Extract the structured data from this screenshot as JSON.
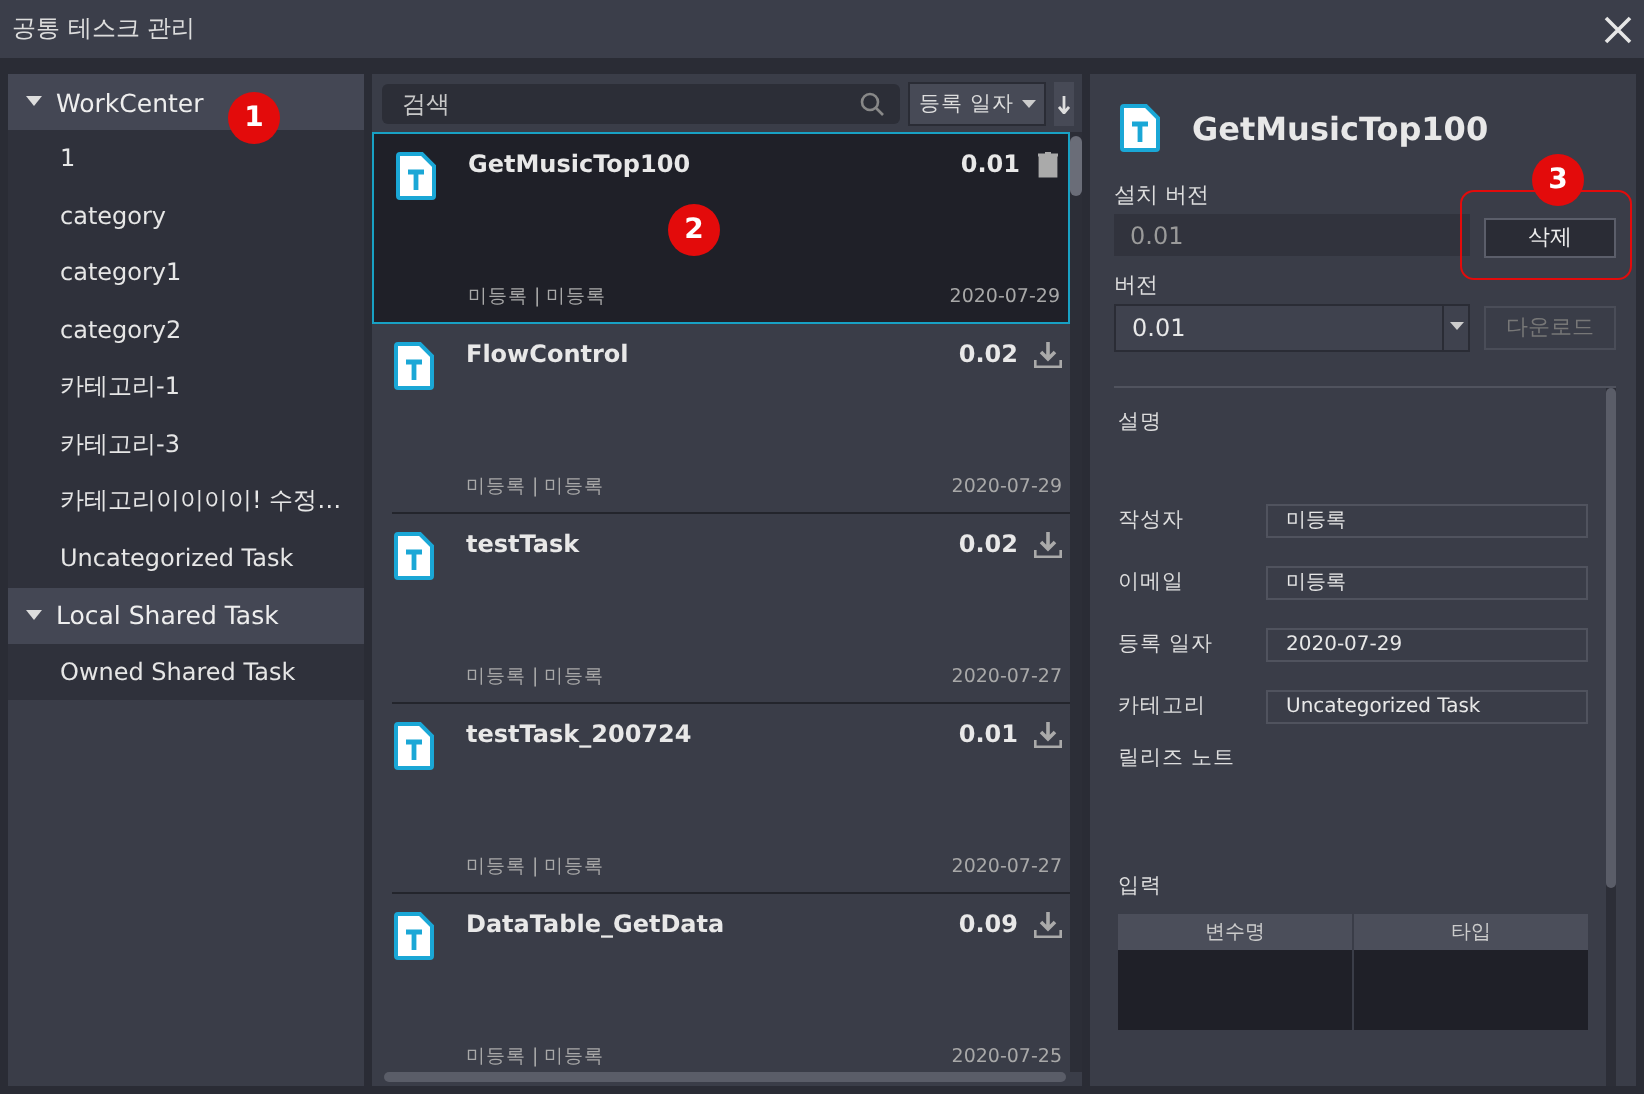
{
  "window": {
    "title": "공통 테스크 관리"
  },
  "sidebar": {
    "callout": "1",
    "groups": [
      {
        "label": "WorkCenter",
        "expanded": true,
        "children": [
          {
            "label": "1"
          },
          {
            "label": "category"
          },
          {
            "label": "category1"
          },
          {
            "label": "category2"
          },
          {
            "label": "카테고리-1"
          },
          {
            "label": "카테고리-3"
          },
          {
            "label": "카테고리이이이이! 수정…"
          },
          {
            "label": "Uncategorized Task"
          }
        ]
      },
      {
        "label": "Local Shared Task",
        "expanded": true,
        "children": [
          {
            "label": "Owned Shared Task"
          }
        ]
      }
    ]
  },
  "task_list": {
    "search": {
      "placeholder": "검색"
    },
    "sort": "등록 일자",
    "tasks": [
      {
        "name": "GetMusicTop100",
        "version": "0.01",
        "status": "미등록 | 미등록",
        "date": "2020-07-29",
        "selected": true,
        "kind": "delete",
        "callout": "2"
      },
      {
        "name": "FlowControl",
        "version": "0.02",
        "status": "미등록 | 미등록",
        "date": "2020-07-29",
        "selected": false,
        "kind": "download"
      },
      {
        "name": "testTask",
        "version": "0.02",
        "status": "미등록 | 미등록",
        "date": "2020-07-27",
        "selected": false,
        "kind": "download"
      },
      {
        "name": "testTask_200724",
        "version": "0.01",
        "status": "미등록 | 미등록",
        "date": "2020-07-27",
        "selected": false,
        "kind": "download"
      },
      {
        "name": "DataTable_GetData",
        "version": "0.09",
        "status": "미등록 | 미등록",
        "date": "2020-07-25",
        "selected": false,
        "kind": "download"
      }
    ]
  },
  "detail": {
    "title": "GetMusicTop100",
    "installed_version": {
      "label": "설치 버전",
      "value": "0.01"
    },
    "delete_button": {
      "label": "삭제",
      "callout": "3"
    },
    "version": {
      "label": "버전",
      "value": "0.01"
    },
    "download_button": {
      "label": "다운로드",
      "disabled": true
    },
    "description_label": "설명",
    "fields": [
      {
        "label": "작성자",
        "value": "미등록"
      },
      {
        "label": "이메일",
        "value": "미등록"
      },
      {
        "label": "등록 일자",
        "value": "2020-07-29"
      },
      {
        "label": "카테고리",
        "value": "Uncategorized Task"
      }
    ],
    "release_notes_label": "릴리즈 노트",
    "input_label": "입력",
    "input_columns": [
      "변수명",
      "타입"
    ]
  }
}
